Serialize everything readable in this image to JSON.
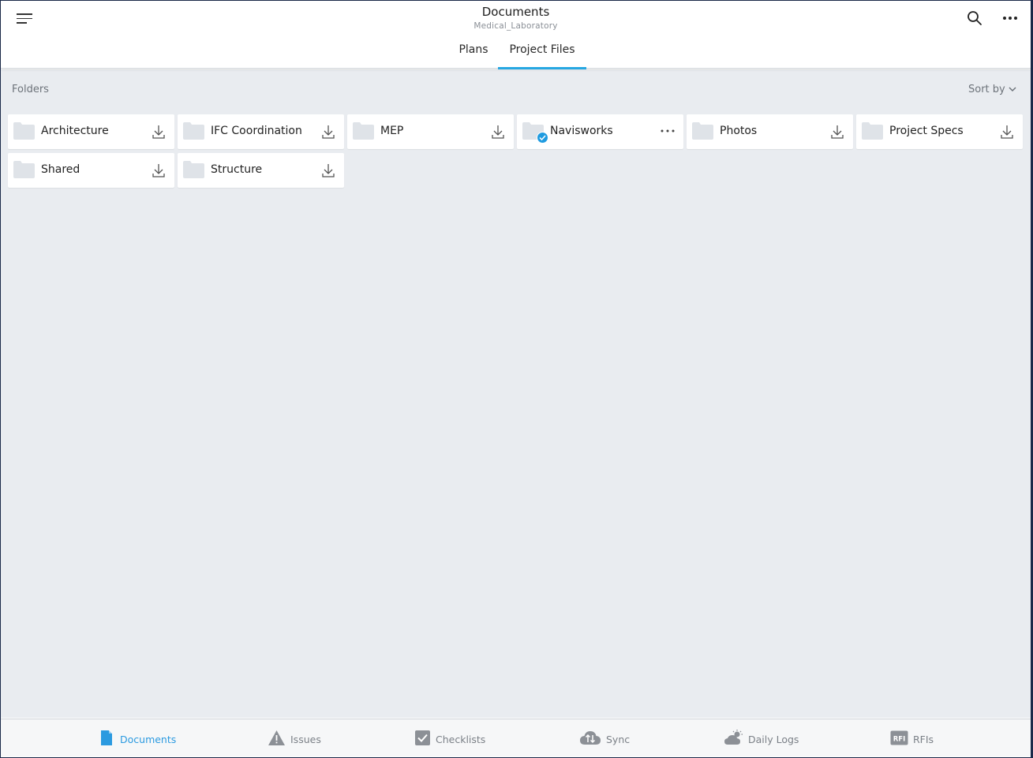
{
  "header": {
    "title": "Documents",
    "subtitle": "Medical_Laboratory",
    "tabs": [
      {
        "label": "Plans",
        "active": false
      },
      {
        "label": "Project Files",
        "active": true
      }
    ]
  },
  "content": {
    "section_label": "Folders",
    "sort_label": "Sort by",
    "folders": [
      {
        "name": "Architecture",
        "action": "download-icon"
      },
      {
        "name": "IFC Coordination",
        "action": "download-icon"
      },
      {
        "name": "MEP",
        "action": "download-icon"
      },
      {
        "name": "Navisworks",
        "action": "more-icon",
        "synced": true
      },
      {
        "name": "Photos",
        "action": "download-icon"
      },
      {
        "name": "Project Specs",
        "action": "download-icon"
      },
      {
        "name": "Shared",
        "action": "download-icon"
      },
      {
        "name": "Structure",
        "action": "download-icon"
      }
    ]
  },
  "bottom_nav": {
    "items": [
      {
        "label": "Documents",
        "icon": "document-icon",
        "active": true
      },
      {
        "label": "Issues",
        "icon": "warning-icon",
        "active": false
      },
      {
        "label": "Checklists",
        "icon": "checkbox-icon",
        "active": false
      },
      {
        "label": "Sync",
        "icon": "cloud-sync-icon",
        "active": false
      },
      {
        "label": "Daily Logs",
        "icon": "weather-icon",
        "active": false
      },
      {
        "label": "RFIs",
        "icon": "rfi-icon",
        "active": false
      }
    ]
  },
  "colors": {
    "accent": "#26a7e2",
    "background": "#e9ecf0",
    "folder": "#dfe3e8",
    "inactive_nav": "#7b8087"
  }
}
